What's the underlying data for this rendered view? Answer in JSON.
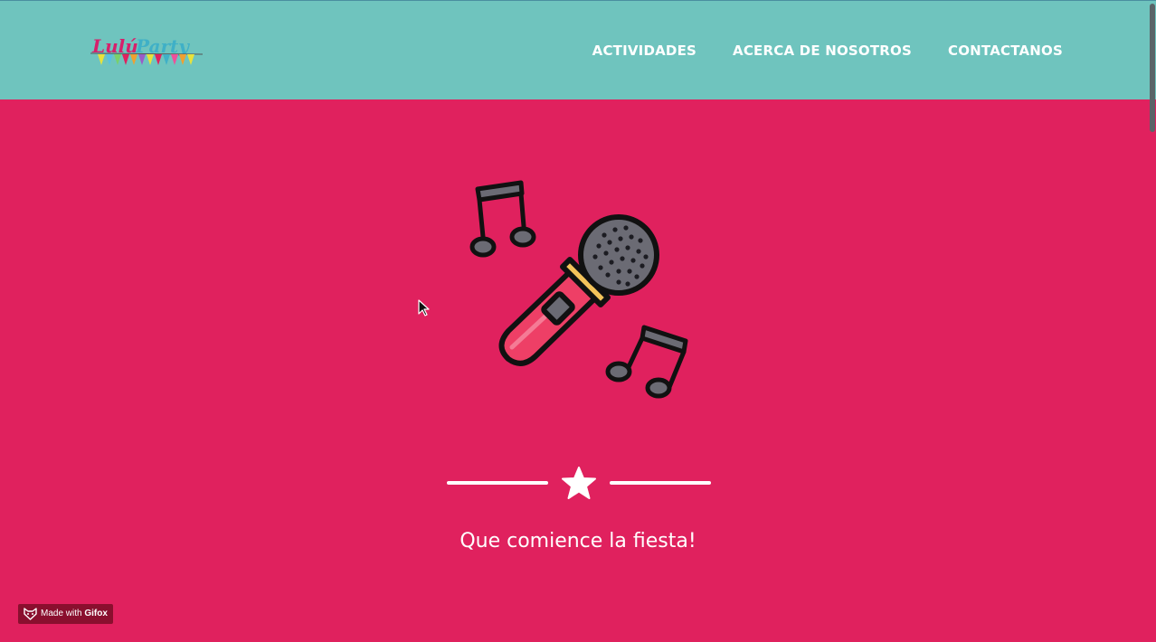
{
  "header": {
    "logo": {
      "part1": "Lulú",
      "part2": "Party"
    },
    "nav": [
      {
        "label": "ACTIVIDADES"
      },
      {
        "label": "ACERCA DE NOSOTROS"
      },
      {
        "label": "CONTACTANOS"
      }
    ]
  },
  "hero": {
    "icon": "microphone-with-music-notes-icon",
    "divider_icon": "star-icon",
    "tagline": "Que comience la fiesta!"
  },
  "badge": {
    "prefix": "Made with",
    "brand": "Gifox",
    "icon": "fox-icon"
  },
  "colors": {
    "background": "#e0215e",
    "navbar": "#6fc4be",
    "text": "#ffffff",
    "logo_pink": "#d6206b",
    "logo_teal": "#3fb0c7",
    "badge_bg": "#8a0f2e"
  }
}
